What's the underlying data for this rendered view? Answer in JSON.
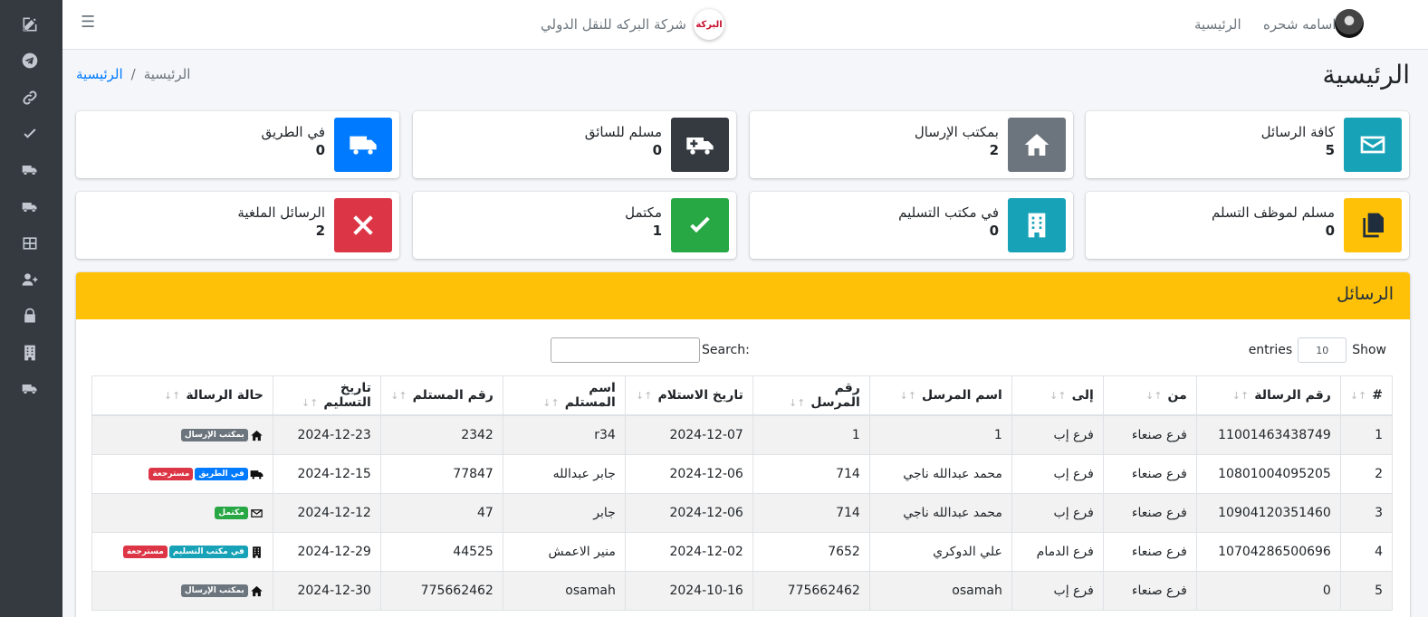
{
  "navbar": {
    "brand_logo_text": "البركة",
    "brand_name": "شركة البركه للنقل الدولي",
    "home_link": "الرئيسية",
    "user_name": "اسامه شحره"
  },
  "page": {
    "title": "الرئيسية",
    "breadcrumb": {
      "link": "الرئيسية",
      "separator": "/",
      "active": "الرئيسية"
    }
  },
  "sidebar_icons": [
    "edit-icon",
    "telegram-icon",
    "link-icon",
    "check-icon",
    "truck-icon",
    "truck-moving-icon",
    "table-icon",
    "user-plus-icon",
    "lock-icon",
    "building-icon",
    "truck-icon"
  ],
  "info_boxes": [
    {
      "label": "كافة الرسائل",
      "value": "5",
      "color": "#17a2b8",
      "icon": "envelope-icon"
    },
    {
      "label": "بمكتب الإرسال",
      "value": "2",
      "color": "#6c757d",
      "icon": "home-icon"
    },
    {
      "label": "مسلم للسائق",
      "value": "0",
      "color": "#343a40",
      "icon": "ambulance-icon"
    },
    {
      "label": "في الطريق",
      "value": "0",
      "color": "#007bff",
      "icon": "truck-icon"
    },
    {
      "label": "مسلم لموظف التسلم",
      "value": "0",
      "color": "#ffc107",
      "icon": "copy-icon"
    },
    {
      "label": "في مكتب التسليم",
      "value": "0",
      "color": "#17a2b8",
      "icon": "building-icon"
    },
    {
      "label": "مكتمل",
      "value": "1",
      "color": "#28a745",
      "icon": "check-icon"
    },
    {
      "label": "الرسائل الملغية",
      "value": "2",
      "color": "#dc3545",
      "icon": "times-icon"
    }
  ],
  "card": {
    "title": "الرسائل",
    "show_label": "Show",
    "entries_value": "10",
    "entries_label": "entries",
    "search_label": "Search:"
  },
  "table": {
    "columns": [
      "#",
      "رقم الرسالة",
      "من",
      "إلى",
      "اسم المرسل",
      "رقم المرسل",
      "تاريخ الاستلام",
      "اسم المستلم",
      "رقم المستلم",
      "تاريخ التسليم",
      "حالة الرسالة"
    ],
    "rows": [
      {
        "n": "1",
        "msg": "11001463438749",
        "from": "فرع صنعاء",
        "to": "فرع إب",
        "sender": "1",
        "sender_no": "1",
        "recv_date": "2024-12-07",
        "receiver": "r34",
        "receiver_no": "2342",
        "deliv_date": "2024-12-23",
        "status_icon": "home-icon",
        "badges": [
          {
            "text": "بمكتب الإرسال",
            "color": "#6c757d"
          }
        ]
      },
      {
        "n": "2",
        "msg": "10801004095205",
        "from": "فرع صنعاء",
        "to": "فرع إب",
        "sender": "محمد عبدالله ناجي",
        "sender_no": "714",
        "recv_date": "2024-12-06",
        "receiver": "جابر عبدالله",
        "receiver_no": "77847",
        "deliv_date": "2024-12-15",
        "status_icon": "truck-icon",
        "badges": [
          {
            "text": "في الطريق",
            "color": "#007bff"
          },
          {
            "text": "مسترجعة",
            "color": "#dc3545"
          }
        ]
      },
      {
        "n": "3",
        "msg": "10904120351460",
        "from": "فرع صنعاء",
        "to": "فرع إب",
        "sender": "محمد عبدالله ناجي",
        "sender_no": "714",
        "recv_date": "2024-12-06",
        "receiver": "جابر",
        "receiver_no": "47",
        "deliv_date": "2024-12-12",
        "status_icon": "envelope-icon",
        "badges": [
          {
            "text": "مكتمل",
            "color": "#28a745"
          }
        ]
      },
      {
        "n": "4",
        "msg": "10704286500696",
        "from": "فرع صنعاء",
        "to": "فرع الدمام",
        "sender": "علي الدوكري",
        "sender_no": "7652",
        "recv_date": "2024-12-02",
        "receiver": "منير الاعمش",
        "receiver_no": "44525",
        "deliv_date": "2024-12-29",
        "status_icon": "building-icon",
        "badges": [
          {
            "text": "في مكتب التسليم",
            "color": "#17a2b8"
          },
          {
            "text": "مسترجعة",
            "color": "#dc3545"
          }
        ]
      },
      {
        "n": "5",
        "msg": "0",
        "from": "فرع صنعاء",
        "to": "فرع إب",
        "sender": "osamah",
        "sender_no": "775662462",
        "recv_date": "2024-10-16",
        "receiver": "osamah",
        "receiver_no": "775662462",
        "deliv_date": "2024-12-30",
        "status_icon": "home-icon",
        "badges": [
          {
            "text": "بمكتب الإرسال",
            "color": "#6c757d"
          }
        ]
      }
    ]
  }
}
